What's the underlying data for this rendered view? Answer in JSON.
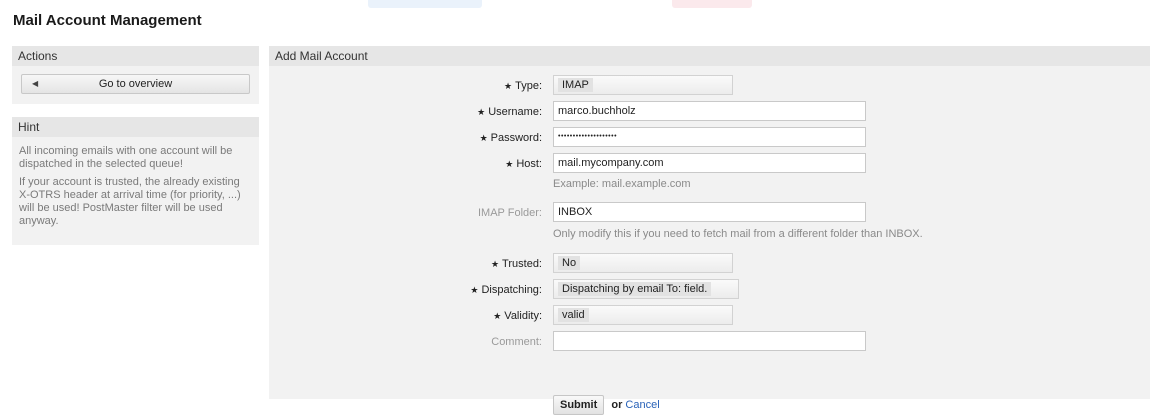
{
  "page": {
    "title": "Mail Account Management"
  },
  "sidebar": {
    "actions": {
      "header": "Actions",
      "overview_button": "Go to overview"
    },
    "hint": {
      "header": "Hint",
      "paragraphs": [
        "All incoming emails with one account will be dispatched in the selected queue!",
        "If your account is trusted, the already existing X-OTRS header at arrival time (for priority, ...) will be used! PostMaster filter will be used anyway."
      ]
    }
  },
  "main": {
    "header": "Add Mail Account",
    "form": {
      "type": {
        "label": "Type:",
        "value": "IMAP"
      },
      "username": {
        "label": "Username:",
        "value": "marco.buchholz"
      },
      "password": {
        "label": "Password:",
        "value": "••••••••••••••••••••"
      },
      "host": {
        "label": "Host:",
        "value": "mail.mycompany.com",
        "help": "Example: mail.example.com"
      },
      "imap_folder": {
        "label": "IMAP Folder:",
        "value": "INBOX",
        "help": "Only modify this if you need to fetch mail from a different folder than INBOX."
      },
      "trusted": {
        "label": "Trusted:",
        "value": "No"
      },
      "dispatching": {
        "label": "Dispatching:",
        "value": "Dispatching by email To: field."
      },
      "validity": {
        "label": "Validity:",
        "value": "valid"
      },
      "comment": {
        "label": "Comment:",
        "value": ""
      },
      "submit_label": "Submit",
      "or_text": "or",
      "cancel_label": "Cancel"
    }
  },
  "required_marker": "★"
}
